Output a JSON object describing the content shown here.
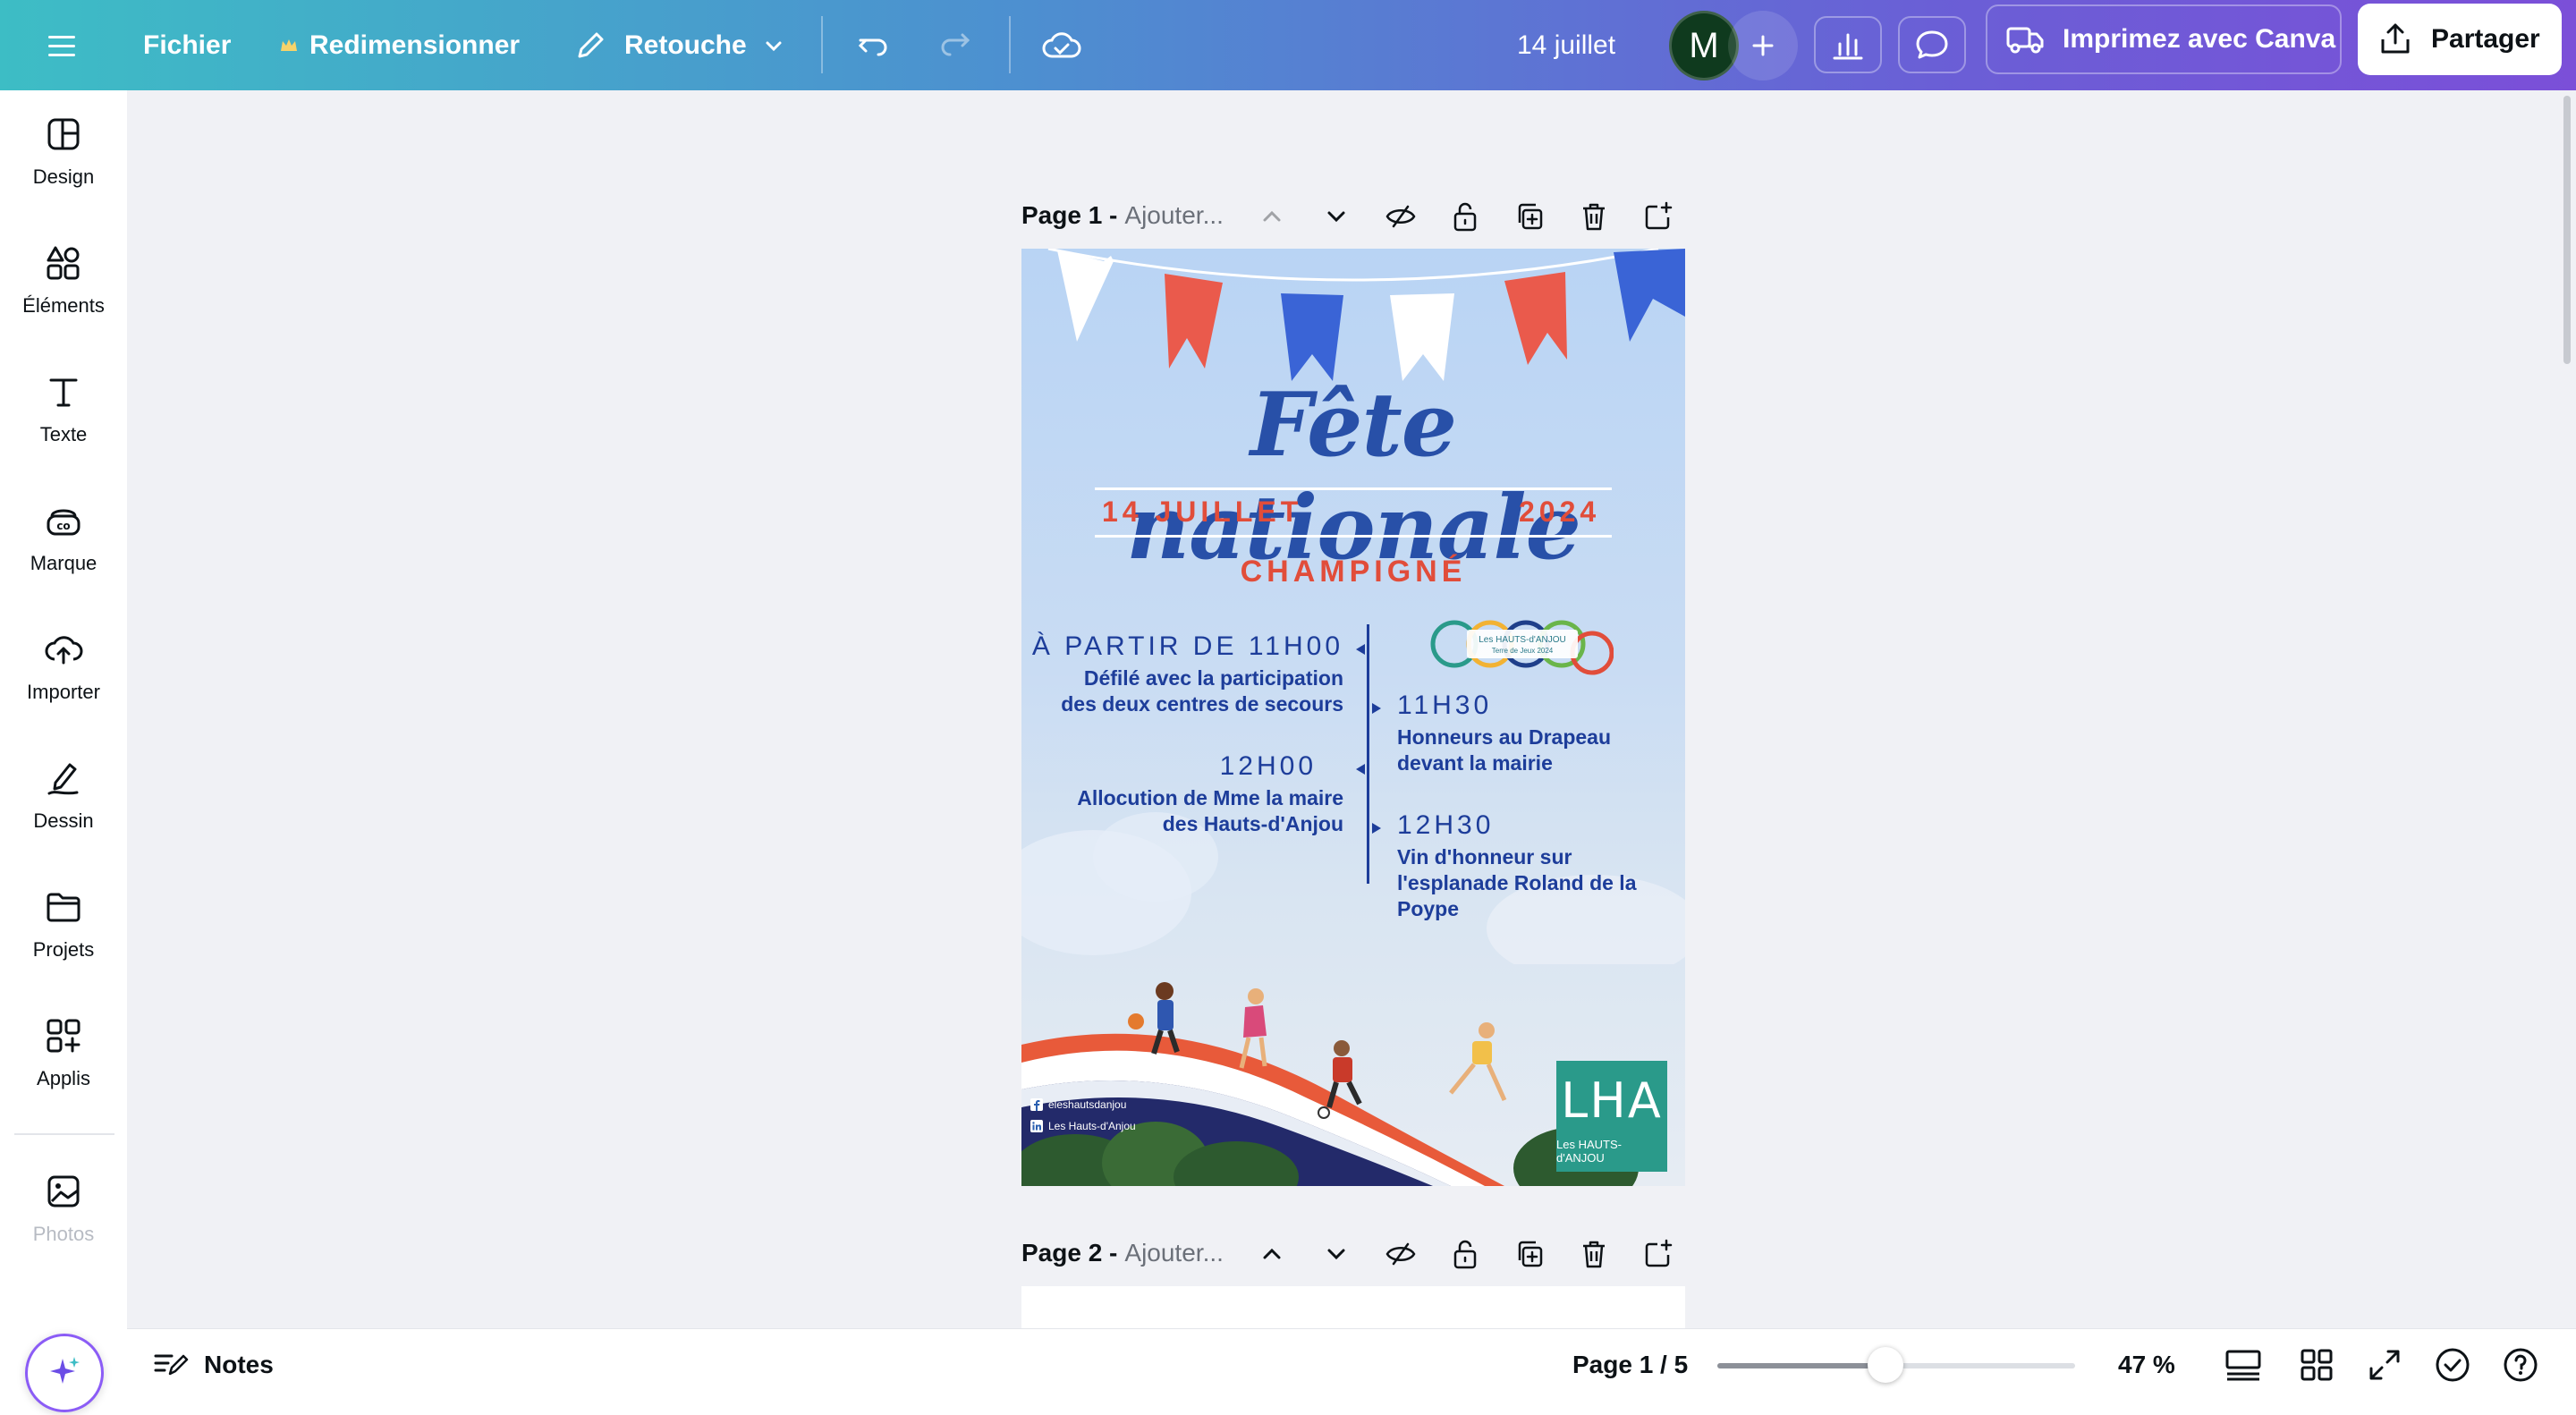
{
  "topbar": {
    "file_label": "Fichier",
    "resize_label": "Redimensionner",
    "retouch_label": "Retouche",
    "doc_title": "14 juillet",
    "avatar_initial": "M",
    "print_label": "Imprimez avec Canva",
    "share_label": "Partager"
  },
  "sidebar": {
    "items": [
      {
        "label": "Design",
        "icon": "layout-icon"
      },
      {
        "label": "Éléments",
        "icon": "shapes-icon"
      },
      {
        "label": "Texte",
        "icon": "text-icon"
      },
      {
        "label": "Marque",
        "icon": "brand-icon"
      },
      {
        "label": "Importer",
        "icon": "upload-cloud-icon"
      },
      {
        "label": "Dessin",
        "icon": "draw-icon"
      },
      {
        "label": "Projets",
        "icon": "folder-icon"
      },
      {
        "label": "Applis",
        "icon": "apps-icon"
      },
      {
        "label": "Photos",
        "icon": "image-icon"
      }
    ]
  },
  "pages": [
    {
      "name": "Page 1 -",
      "sub": "Ajouter..."
    },
    {
      "name": "Page 2 -",
      "sub": "Ajouter..."
    }
  ],
  "poster": {
    "title": "Fête nationale",
    "date_left": "14 JUILLET",
    "date_right": "2024",
    "town": "CHAMPIGNÉ",
    "badge_line1": "Les HAUTS-d'ANJOU",
    "badge_line2": "Terre de Jeux 2024",
    "events": [
      {
        "time": "À PARTIR DE 11H00",
        "desc1": "Défilé avec la participation",
        "desc2": "des deux centres de secours"
      },
      {
        "time": "11H30",
        "desc1": "Honneurs au Drapeau",
        "desc2": "devant la mairie"
      },
      {
        "time": "12H00",
        "desc1": "Allocution de Mme la maire",
        "desc2": "des Hauts-d'Anjou"
      },
      {
        "time": "12H30",
        "desc1": "Vin d'honneur sur",
        "desc2": "l'esplanade Roland de la",
        "desc3": "Poype"
      }
    ],
    "social_fb": "eleshautsdanjou",
    "social_li": "Les Hauts-d'Anjou",
    "logo_big": "LHA",
    "logo_small": "Les HAUTS-d'ANJOU"
  },
  "bottombar": {
    "notes_label": "Notes",
    "page_counter": "Page 1 / 5",
    "zoom_label": "47 %",
    "zoom_percent": 47
  },
  "colors": {
    "accent_blue": "#2850a8",
    "accent_red": "#e14d3a",
    "text_navy": "#1d3d9a"
  }
}
